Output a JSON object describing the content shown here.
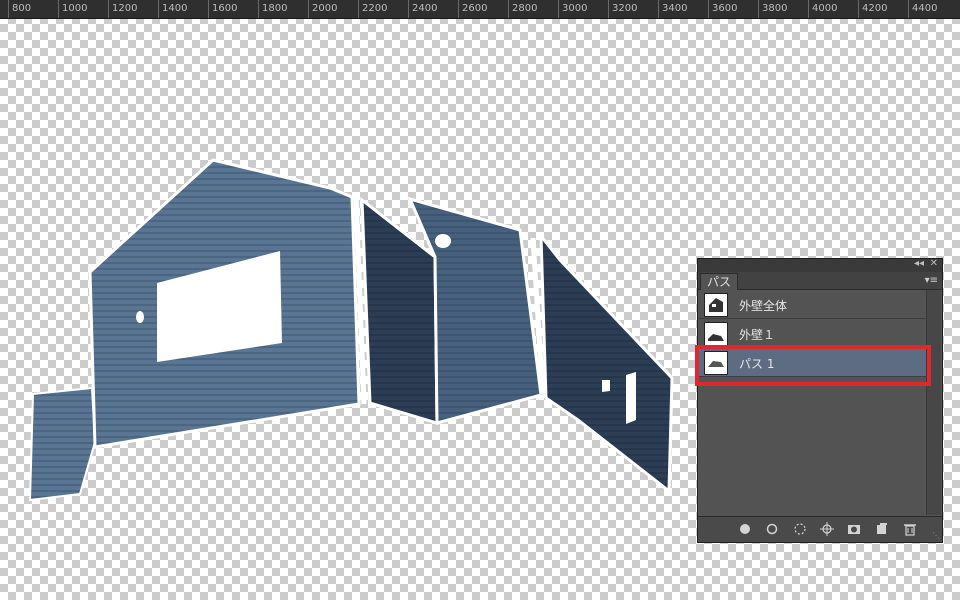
{
  "ruler": {
    "labels": [
      "800",
      "1000",
      "1200",
      "1400",
      "1600",
      "1800",
      "2000",
      "2200",
      "2400",
      "2600",
      "2800",
      "3000",
      "3200",
      "3400",
      "3600",
      "3800",
      "4000",
      "4200",
      "4400"
    ]
  },
  "paths_panel": {
    "tab_label": "パス",
    "collapse_icon": "double-chevron-icon",
    "close_icon": "close-icon",
    "menu_icon": "panel-menu-icon",
    "items": [
      {
        "label": "外壁全体",
        "selected": false
      },
      {
        "label": "外壁１",
        "selected": false
      },
      {
        "label": "パス 1",
        "selected": true
      }
    ],
    "footer_icons": [
      "fill-path-icon",
      "stroke-path-icon",
      "load-selection-icon",
      "make-path-from-selection-icon",
      "add-mask-icon",
      "new-path-icon",
      "trash-icon"
    ]
  },
  "colors": {
    "highlight": "#e0262e",
    "selected_row": "#5d6c83",
    "wall_blue": "#4e6885"
  }
}
